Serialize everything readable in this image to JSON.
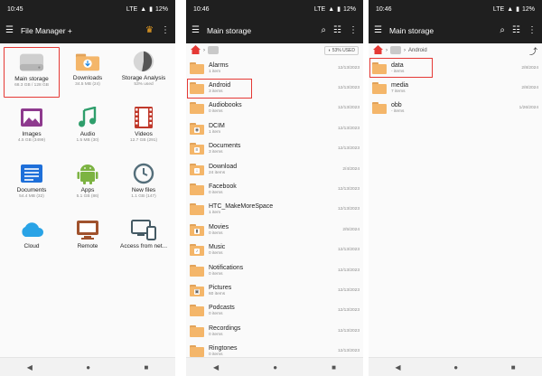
{
  "colors": {
    "accent": "#1e88e5",
    "highlight": "#e53935",
    "folder": "#f4b66a",
    "appbar": "#1f1f1f"
  },
  "screen1": {
    "time": "10:45",
    "network": "LTE",
    "battery": "12%",
    "title": "File Manager +",
    "tiles": [
      {
        "label": "Main storage",
        "sub": "68.3 GB / 128 GB",
        "icon": "storage-drive-icon"
      },
      {
        "label": "Downloads",
        "sub": "34.5 MB (24)",
        "icon": "download-icon"
      },
      {
        "label": "Storage Analysis",
        "sub": "53% used",
        "icon": "pie-chart-icon"
      },
      {
        "label": "Images",
        "sub": "4.5 GB (3499)",
        "icon": "image-icon"
      },
      {
        "label": "Audio",
        "sub": "1.5 MB (30)",
        "icon": "music-note-icon"
      },
      {
        "label": "Videos",
        "sub": "12.7 GB (291)",
        "icon": "film-strip-icon"
      },
      {
        "label": "Documents",
        "sub": "54.4 MB (32)",
        "icon": "document-icon"
      },
      {
        "label": "Apps",
        "sub": "5.1 GB (86)",
        "icon": "android-icon"
      },
      {
        "label": "New files",
        "sub": "1.1 GB (147)",
        "icon": "clock-icon"
      },
      {
        "label": "Cloud",
        "sub": "",
        "icon": "cloud-icon"
      },
      {
        "label": "Remote",
        "sub": "",
        "icon": "remote-icon"
      },
      {
        "label": "Access from net...",
        "sub": "",
        "icon": "monitor-phone-icon"
      }
    ]
  },
  "screen2": {
    "time": "10:46",
    "network": "LTE",
    "battery": "12%",
    "title": "Main storage",
    "used": "53% USED",
    "rows": [
      {
        "name": "Alarms",
        "sub": "1 item",
        "date": "12/13/2023",
        "badge": ""
      },
      {
        "name": "Android",
        "sub": "3 items",
        "date": "12/13/2023",
        "badge": ""
      },
      {
        "name": "Audiobooks",
        "sub": "0 items",
        "date": "12/13/2023",
        "badge": ""
      },
      {
        "name": "DCIM",
        "sub": "1 item",
        "date": "12/13/2023",
        "badge": "camera"
      },
      {
        "name": "Documents",
        "sub": "3 items",
        "date": "12/13/2023",
        "badge": "doc"
      },
      {
        "name": "Download",
        "sub": "24 items",
        "date": "2/4/2024",
        "badge": "down"
      },
      {
        "name": "Facebook",
        "sub": "0 items",
        "date": "12/13/2023",
        "badge": ""
      },
      {
        "name": "HTC_MakeMoreSpace",
        "sub": "1 item",
        "date": "12/13/2023",
        "badge": ""
      },
      {
        "name": "Movies",
        "sub": "0 items",
        "date": "2/5/2024",
        "badge": "film"
      },
      {
        "name": "Music",
        "sub": "0 items",
        "date": "12/13/2023",
        "badge": "music"
      },
      {
        "name": "Notifications",
        "sub": "0 items",
        "date": "12/13/2023",
        "badge": ""
      },
      {
        "name": "Pictures",
        "sub": "60 items",
        "date": "12/13/2023",
        "badge": "image"
      },
      {
        "name": "Podcasts",
        "sub": "0 items",
        "date": "12/13/2023",
        "badge": ""
      },
      {
        "name": "Recordings",
        "sub": "0 items",
        "date": "12/13/2023",
        "badge": ""
      },
      {
        "name": "Ringtones",
        "sub": "0 items",
        "date": "12/13/2023",
        "badge": ""
      }
    ]
  },
  "screen3": {
    "time": "10:46",
    "network": "LTE",
    "battery": "12%",
    "title": "Main storage",
    "path": "Android",
    "rows": [
      {
        "name": "data",
        "sub": "- items",
        "date": "2/8/2024"
      },
      {
        "name": "media",
        "sub": "7 items",
        "date": "2/8/2024"
      },
      {
        "name": "obb",
        "sub": "- items",
        "date": "1/26/2024"
      }
    ]
  }
}
